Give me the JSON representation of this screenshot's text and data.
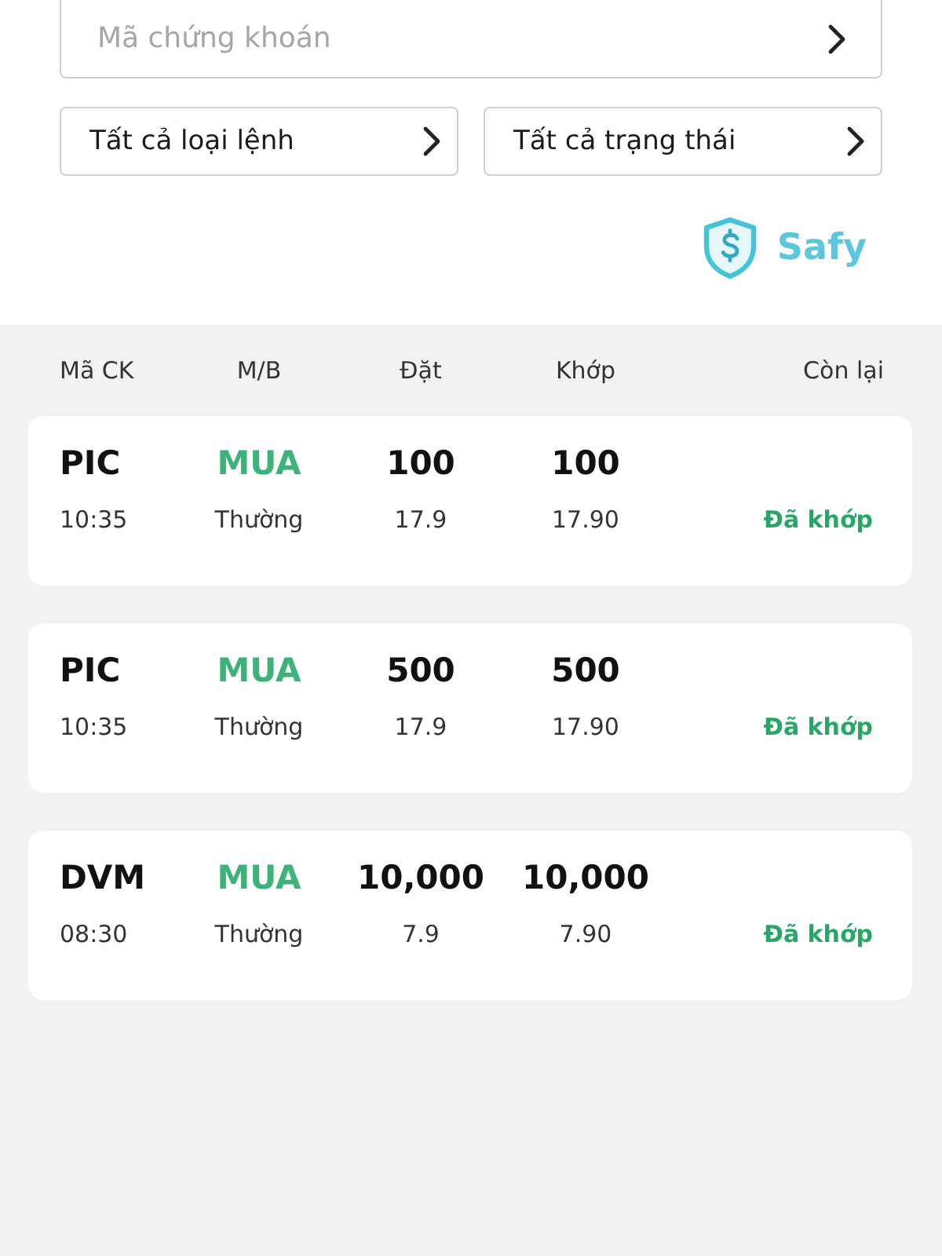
{
  "search": {
    "placeholder": "Mã chứng khoán"
  },
  "filters": [
    {
      "label": "Tất cả loại lệnh"
    },
    {
      "label": "Tất cả trạng thái"
    }
  ],
  "logo": {
    "text": "Safy"
  },
  "table": {
    "columns": [
      "Mã CK",
      "M/B",
      "Đặt",
      "Khớp",
      "Còn lại"
    ],
    "orders": [
      {
        "symbol": "PIC",
        "side": "MUA",
        "order_qty": "100",
        "matched_qty": "100",
        "time": "10:35",
        "order_type": "Thường",
        "order_price": "17.9",
        "matched_price": "17.90",
        "status": "Đã khớp"
      },
      {
        "symbol": "PIC",
        "side": "MUA",
        "order_qty": "500",
        "matched_qty": "500",
        "time": "10:35",
        "order_type": "Thường",
        "order_price": "17.9",
        "matched_price": "17.90",
        "status": "Đã khớp"
      },
      {
        "symbol": "DVM",
        "side": "MUA",
        "order_qty": "10,000",
        "matched_qty": "10,000",
        "time": "08:30",
        "order_type": "Thường",
        "order_price": "7.9",
        "matched_price": "7.90",
        "status": "Đã khớp"
      }
    ]
  }
}
